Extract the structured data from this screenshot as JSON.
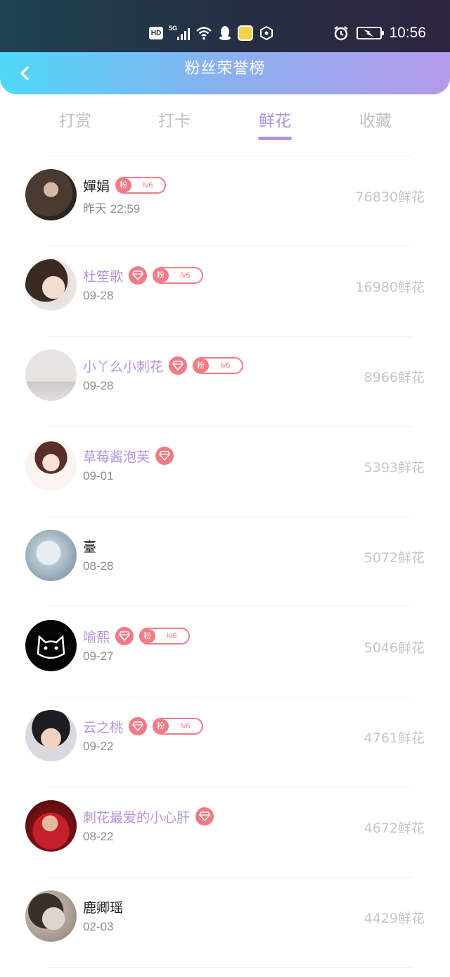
{
  "status_bar": {
    "hd": "HD",
    "network": "5G",
    "time": "10:56"
  },
  "header": {
    "title": "粉丝荣誉榜"
  },
  "tabs": [
    {
      "label": "打赏"
    },
    {
      "label": "打卡"
    },
    {
      "label": "鲜花",
      "active": true
    },
    {
      "label": "收藏"
    }
  ],
  "colors": {
    "accent": "#b192e0",
    "badge": "#f17a86",
    "header_start": "#4ed8f8",
    "header_end": "#b49aea"
  },
  "rows": [
    {
      "name": "嬋娟",
      "vip": false,
      "gem": false,
      "fan_label": "粉",
      "level": "lv6",
      "date": "昨天 22:59",
      "count": "76830鲜花"
    },
    {
      "name": "杜笙歌",
      "vip": true,
      "gem": true,
      "fan_label": "粉",
      "level": "lv6",
      "date": "09-28",
      "count": "16980鲜花"
    },
    {
      "name": "小丫么小刺花",
      "vip": true,
      "gem": true,
      "fan_label": "粉",
      "level": "lv6",
      "date": "09-28",
      "count": "8966鲜花"
    },
    {
      "name": "草莓酱泡芙",
      "vip": true,
      "gem": true,
      "date": "09-01",
      "count": "5393鲜花"
    },
    {
      "name": "臺",
      "vip": false,
      "gem": false,
      "date": "08-28",
      "count": "5072鲜花"
    },
    {
      "name": "喻熙",
      "vip": true,
      "gem": true,
      "fan_label": "粉",
      "level": "lv6",
      "date": "09-27",
      "count": "5046鲜花"
    },
    {
      "name": "云之桃",
      "vip": true,
      "gem": true,
      "fan_label": "粉",
      "level": "lv6",
      "date": "09-22",
      "count": "4761鲜花"
    },
    {
      "name": "刺花最爱的小心肝",
      "vip": true,
      "gem": true,
      "date": "08-22",
      "count": "4672鲜花"
    },
    {
      "name": "鹿卿瑶",
      "vip": false,
      "gem": false,
      "date": "02-03",
      "count": "4429鲜花"
    }
  ]
}
